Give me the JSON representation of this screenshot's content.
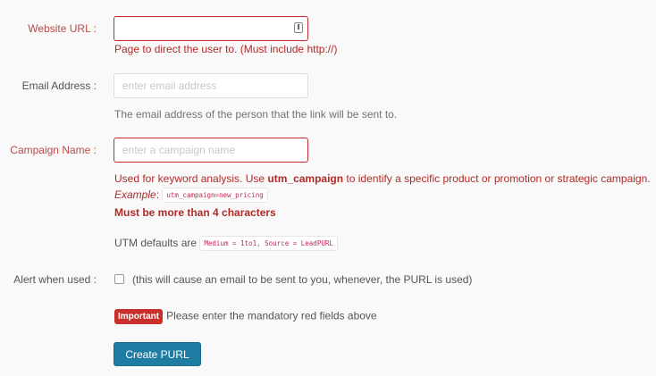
{
  "form": {
    "website": {
      "label": "Website URL :",
      "value": "",
      "help": "Page to direct the user to. (Must include http://)"
    },
    "email": {
      "label": "Email Address :",
      "placeholder": "enter email address",
      "help": "The email address of the person that the link will be sent to."
    },
    "campaign": {
      "label": "Campaign Name :",
      "placeholder": "enter a campaign name",
      "help_prefix": "Used for keyword analysis. Use ",
      "help_strong": "utm_campaign",
      "help_suffix": " to identify a specific product or promotion or strategic campaign.",
      "example_label": "Example",
      "example_colon": ":",
      "example_code": "utm_campaign=new_pricing",
      "error": "Must be more than 4 characters"
    },
    "utm": {
      "text": "UTM defaults are",
      "code": "Medium = 1to1, Source = LeadPURL"
    },
    "alert": {
      "label": "Alert when used :",
      "checked": false,
      "text": "(this will cause an email to be sent to you, whenever, the PURL is used)"
    },
    "notice": {
      "badge": "Important",
      "text": "Please enter the mandatory red fields above"
    },
    "submit_label": "Create PURL"
  },
  "colors": {
    "error": "#b02b27",
    "button": "#1f7ca3",
    "badge": "#c9302c"
  }
}
